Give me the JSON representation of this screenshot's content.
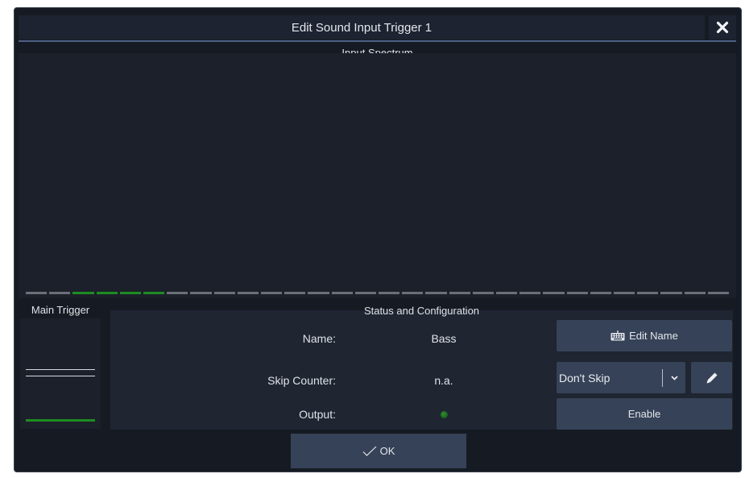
{
  "dialog": {
    "title": "Edit Sound Input Trigger 1",
    "close_icon": "close-x-icon"
  },
  "spectrum": {
    "label": "Input Spectrum",
    "band_count": 30,
    "active_bands": [
      2,
      3,
      4,
      5
    ],
    "colors": {
      "inactive": "#6b7078",
      "active": "#1e8c22"
    }
  },
  "main_trigger": {
    "label": "Main Trigger"
  },
  "status": {
    "label": "Status and Configuration",
    "rows": {
      "name": {
        "label": "Name:",
        "value": "Bass"
      },
      "skip_counter": {
        "label": "Skip Counter:",
        "value": "n.a."
      },
      "output": {
        "label": "Output:",
        "led_state": "on"
      }
    },
    "edit_name_button": {
      "label": "Edit Name",
      "icon": "keyboard-icon"
    },
    "skip_select": {
      "selected": "Don't Skip",
      "icon": "chevron-down-icon"
    },
    "edit_skip_button": {
      "icon": "pencil-icon"
    },
    "enable_button": {
      "label": "Enable"
    }
  },
  "footer": {
    "ok_button": {
      "label": "OK",
      "icon": "checkmark-icon"
    }
  },
  "colors": {
    "dialog_bg": "#161b23",
    "panel_bg": "#1b202a",
    "button_bg": "#364257",
    "accent_line": "#4d6086",
    "led_green": "#2f8f30"
  }
}
